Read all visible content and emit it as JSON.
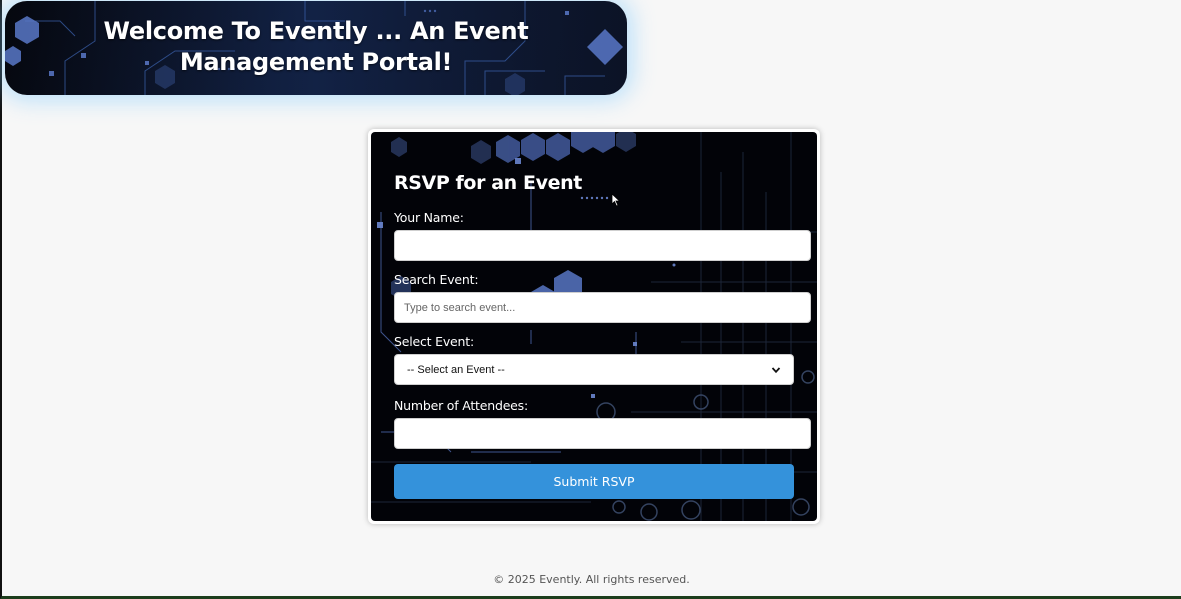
{
  "header": {
    "title": "Welcome To Evently ... An Event Management Portal!"
  },
  "rsvp_form": {
    "title": "RSVP for an Event",
    "name_label": "Your Name:",
    "name_value": "",
    "search_label": "Search Event:",
    "search_placeholder": "Type to search event...",
    "search_value": "",
    "select_label": "Select Event:",
    "select_value": "-- Select an Event --",
    "select_icon": "chevron-down-icon",
    "attendees_label": "Number of Attendees:",
    "attendees_value": "",
    "submit_label": "Submit RSVP"
  },
  "footer": {
    "text": "© 2025 Evently. All rights reserved."
  },
  "colors": {
    "page_background": "#f7f7f7",
    "banner_glow": "#78c8ff",
    "submit_button": "#3492db",
    "card_background": "#020308",
    "hex_accent": "#5a78c8"
  }
}
